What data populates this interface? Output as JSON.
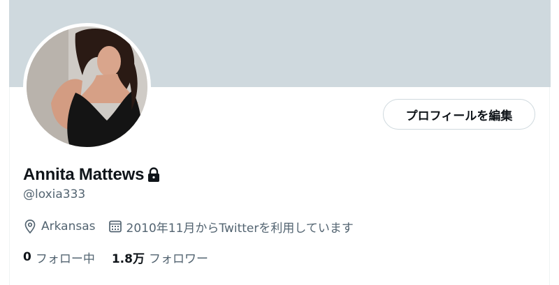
{
  "profile": {
    "display_name": "Annita Mattews",
    "handle": "@loxia333",
    "location": "Arkansas",
    "joined": "2010年11月からTwitterを利用しています",
    "edit_button_label": "プロフィールを編集",
    "following_count": "0",
    "following_label": "フォロー中",
    "followers_count": "1.8万",
    "followers_label": "フォロワー"
  },
  "icons": {
    "lock": "lock-icon",
    "location": "map-pin-icon",
    "calendar": "calendar-icon"
  },
  "colors": {
    "banner": "#cfd9de",
    "text_primary": "#0f1419",
    "text_secondary": "#536471",
    "button_border": "#cfd9de"
  }
}
